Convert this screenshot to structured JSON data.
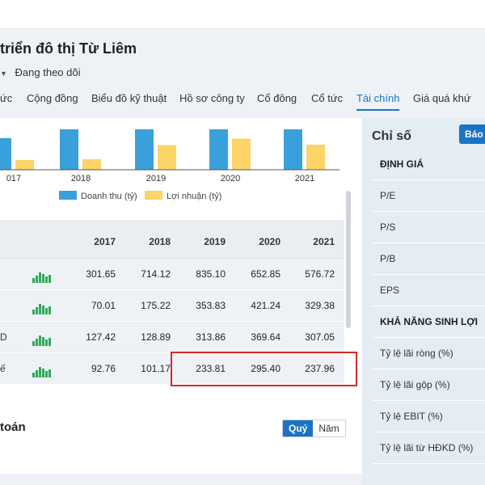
{
  "company": {
    "title": "triển đô thị Từ Liêm",
    "follow_label": "Đang theo dõi"
  },
  "tabs": [
    {
      "label": "ức"
    },
    {
      "label": "Cộng đồng"
    },
    {
      "label": "Biểu đồ kỹ thuật"
    },
    {
      "label": "Hồ sơ công ty"
    },
    {
      "label": "Cổ đông"
    },
    {
      "label": "Cổ tức"
    },
    {
      "label": "Tài chính",
      "active": true
    },
    {
      "label": "Giá quá khứ"
    }
  ],
  "colors": {
    "revenue": "#3aa0dc",
    "profit": "#fcd467",
    "accent": "#1a73c7",
    "highlight": "#d42a2a",
    "spark": "#2eaa5a"
  },
  "chart_data": {
    "type": "bar",
    "categories": [
      "017",
      "2018",
      "2019",
      "2020",
      "2021"
    ],
    "series": [
      {
        "name": "Doanh thu (tỷ)",
        "values": [
          301.65,
          714.12,
          835.1,
          652.85,
          576.72
        ]
      },
      {
        "name": "Lợi nhuận (tỷ)",
        "values": [
          92.76,
          101.17,
          233.81,
          295.4,
          237.96
        ]
      }
    ],
    "legend_position": "bottom"
  },
  "table": {
    "columns": [
      "2017",
      "2018",
      "2019",
      "2020",
      "2021"
    ],
    "rows": [
      {
        "label": "",
        "values": [
          "301.65",
          "714.12",
          "835.10",
          "652.85",
          "576.72"
        ]
      },
      {
        "label": "",
        "values": [
          "70.01",
          "175.22",
          "353.83",
          "421.24",
          "329.38"
        ]
      },
      {
        "label": "D",
        "values": [
          "127.42",
          "128.89",
          "313.86",
          "369.64",
          "307.05"
        ]
      },
      {
        "label": "ế",
        "values": [
          "92.76",
          "101.17",
          "233.81",
          "295.40",
          "237.96"
        ]
      }
    ]
  },
  "section2": {
    "title": "toán",
    "toggle": {
      "on": "Quý",
      "off": "Năm"
    }
  },
  "sidebar": {
    "title": "Chỉ số",
    "button": "Báo",
    "items": [
      {
        "label": "ĐỊNH GIÁ",
        "header": true
      },
      {
        "label": "P/E"
      },
      {
        "label": "P/S"
      },
      {
        "label": "P/B"
      },
      {
        "label": "EPS"
      },
      {
        "label": "KHẢ NĂNG SINH LỢI",
        "header": true
      },
      {
        "label": "Tỷ lệ lãi ròng (%)"
      },
      {
        "label": "Tỷ lệ lãi gộp (%)"
      },
      {
        "label": "Tỷ lệ EBIT (%)"
      },
      {
        "label": "Tỷ lệ lãi từ HĐKD (%)"
      }
    ]
  }
}
